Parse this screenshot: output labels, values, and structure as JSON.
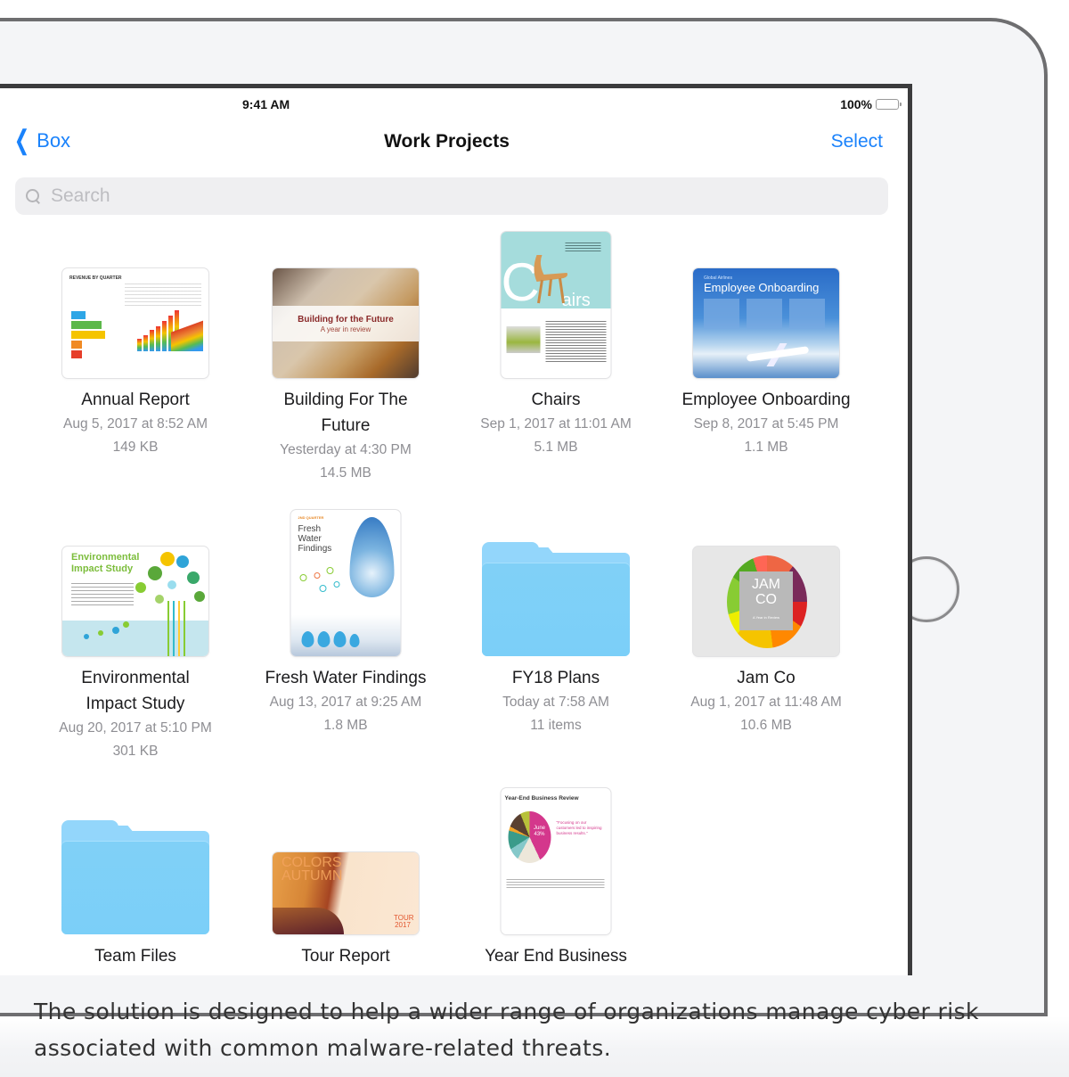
{
  "status_bar": {
    "time": "9:41 AM",
    "battery_percent": "100%",
    "battery_level": 1.0
  },
  "nav": {
    "back_label": "Box",
    "title": "Work Projects",
    "select_label": "Select"
  },
  "search": {
    "placeholder": "Search",
    "value": ""
  },
  "items": [
    {
      "name": "Annual Report",
      "date": "Aug 5, 2017 at 8:52 AM",
      "size": "149 KB",
      "type": "document",
      "thumbnail": "revenue-charts"
    },
    {
      "name": "Building For The Future",
      "date": "Yesterday at 4:30 PM",
      "size": "14.5 MB",
      "type": "presentation",
      "thumbnail_title": "Building for the Future",
      "thumbnail_subtitle": "A year in review"
    },
    {
      "name": "Chairs",
      "date": "Sep 1, 2017 at 11:01 AM",
      "size": "5.1 MB",
      "type": "document",
      "thumbnail_text": "airs"
    },
    {
      "name": "Employee Onboarding",
      "date": "Sep 8, 2017 at 5:45 PM",
      "size": "1.1 MB",
      "type": "presentation",
      "thumbnail_small": "Global Airlines",
      "thumbnail_title": "Employee Onboarding"
    },
    {
      "name": "Environmental Impact Study",
      "date": "Aug 20, 2017 at 5:10 PM",
      "size": "301 KB",
      "type": "document",
      "thumbnail_title": "Environmental Impact Study"
    },
    {
      "name": "Fresh Water Findings",
      "date": "Aug 13, 2017 at 9:25 AM",
      "size": "1.8 MB",
      "type": "document",
      "thumbnail_tag": "2ND QUARTER",
      "thumbnail_title": "Fresh Water Findings"
    },
    {
      "name": "FY18 Plans",
      "date": "Today at 7:58 AM",
      "size": "11 items",
      "type": "folder"
    },
    {
      "name": "Jam Co",
      "date": "Aug 1, 2017 at 11:48 AM",
      "size": "10.6 MB",
      "type": "presentation",
      "thumbnail_title": "JAM CO",
      "thumbnail_subtitle": "A Year in Review"
    },
    {
      "name": "Team Files",
      "type": "folder"
    },
    {
      "name": "Tour Report",
      "type": "presentation",
      "thumbnail_title": "COLORS AUTUMN",
      "thumbnail_badge": "TOUR 2017"
    },
    {
      "name": "Year End Business",
      "type": "document",
      "thumbnail_title": "Year-End Business Review",
      "thumbnail_highlight": "June 43%",
      "thumbnail_quote": "\"Focusing on our customers led to inspiring business results.\""
    }
  ],
  "caption": "The solution is designed to help a wider range of organizations manage cyber risk associated with common malware-related threats.",
  "colors": {
    "accent": "#1a82fb",
    "folder": "#80d0f7",
    "secondary_text": "#8e8e93"
  }
}
